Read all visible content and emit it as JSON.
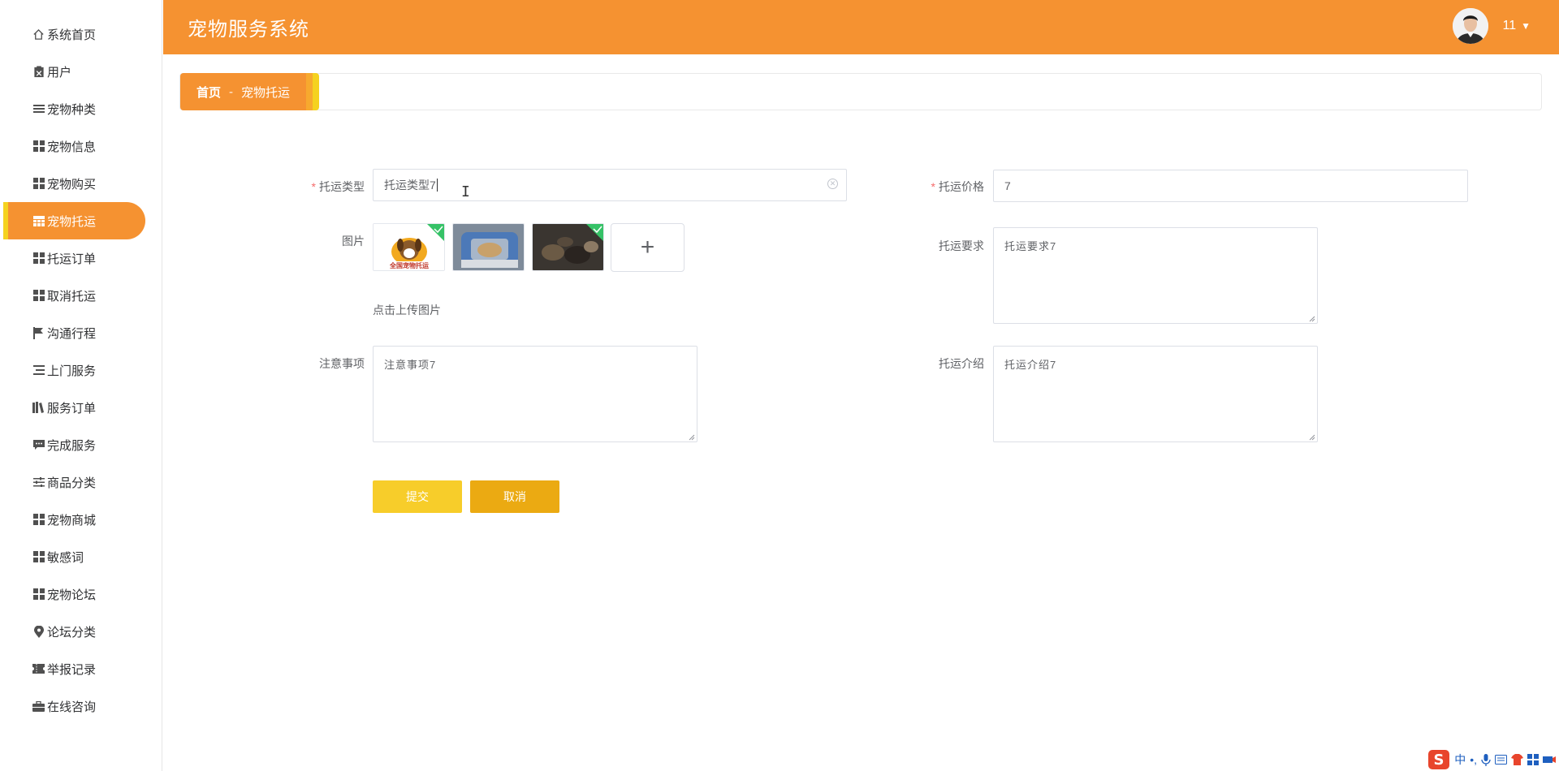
{
  "app": {
    "title": "宠物服务系统"
  },
  "user": {
    "name": "11"
  },
  "sidebar": {
    "items": [
      {
        "label": "系统首页",
        "icon": "home-icon",
        "active": false
      },
      {
        "label": "用户",
        "icon": "clipboard-icon",
        "active": false
      },
      {
        "label": "宠物种类",
        "icon": "list-icon",
        "active": false
      },
      {
        "label": "宠物信息",
        "icon": "grid-icon",
        "active": false
      },
      {
        "label": "宠物购买",
        "icon": "grid-icon",
        "active": false
      },
      {
        "label": "宠物托运",
        "icon": "table-icon",
        "active": true
      },
      {
        "label": "托运订单",
        "icon": "grid-icon",
        "active": false
      },
      {
        "label": "取消托运",
        "icon": "grid-icon",
        "active": false
      },
      {
        "label": "沟通行程",
        "icon": "flag-icon",
        "active": false
      },
      {
        "label": "上门服务",
        "icon": "indent-list-icon",
        "active": false
      },
      {
        "label": "服务订单",
        "icon": "books-icon",
        "active": false
      },
      {
        "label": "完成服务",
        "icon": "chat-icon",
        "active": false
      },
      {
        "label": "商品分类",
        "icon": "sliders-icon",
        "active": false
      },
      {
        "label": "宠物商城",
        "icon": "grid-icon",
        "active": false
      },
      {
        "label": "敏感词",
        "icon": "grid-icon",
        "active": false
      },
      {
        "label": "宠物论坛",
        "icon": "grid-icon",
        "active": false
      },
      {
        "label": "论坛分类",
        "icon": "map-pin-icon",
        "active": false
      },
      {
        "label": "举报记录",
        "icon": "ticket-icon",
        "active": false
      },
      {
        "label": "在线咨询",
        "icon": "briefcase-icon",
        "active": false
      }
    ]
  },
  "breadcrumb": {
    "home": "首页",
    "separator": "-",
    "current": "宠物托运"
  },
  "form": {
    "type_label": "托运类型",
    "type_value": "托运类型7",
    "price_label": "托运价格",
    "price_value": "7",
    "image_label": "图片",
    "upload_tip": "点击上传图片",
    "requirement_label": "托运要求",
    "requirement_value": "托运要求7",
    "notes_label": "注意事项",
    "notes_value": "注意事项7",
    "intro_label": "托运介绍",
    "intro_value": "托运介绍7",
    "required_mark": "*",
    "upload_add_symbol": "+",
    "thumb1_text": "全国宠物托运"
  },
  "buttons": {
    "submit": "提交",
    "cancel": "取消"
  },
  "ime": {
    "zh": "中"
  },
  "colors": {
    "accent": "#f59231",
    "yellow": "#f5d21f",
    "submit": "#f7cd2a",
    "cancel": "#ebaa12"
  }
}
